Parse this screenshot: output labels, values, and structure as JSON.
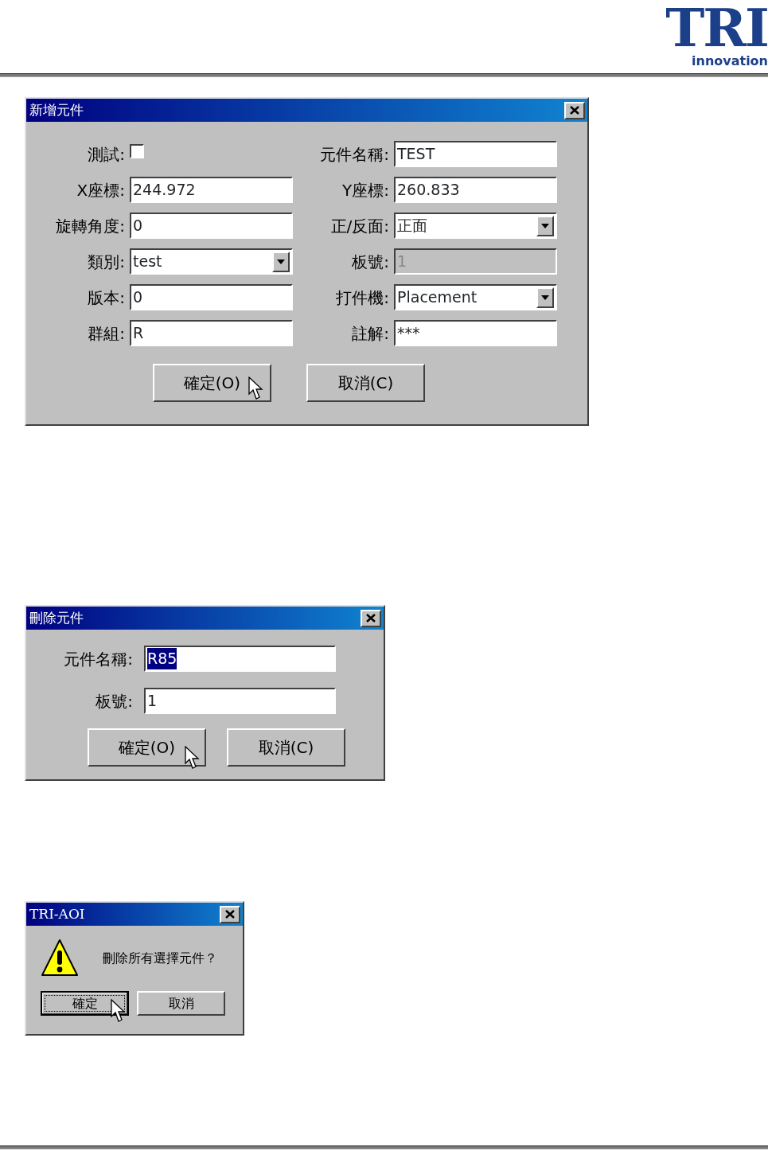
{
  "header": {
    "logo": "TRI",
    "tagline": "innovation"
  },
  "add_dialog": {
    "title": "新增元件",
    "left_fields": [
      {
        "kind": "checkbox",
        "label": "測試:",
        "checked": false,
        "disabled": false
      },
      {
        "kind": "text",
        "label": "X座標:",
        "value": "244.972",
        "disabled": false
      },
      {
        "kind": "text",
        "label": "旋轉角度:",
        "value": "0",
        "disabled": false
      },
      {
        "kind": "combo",
        "label": "類別:",
        "value": "test",
        "disabled": false
      },
      {
        "kind": "text",
        "label": "版本:",
        "value": "0",
        "disabled": false
      },
      {
        "kind": "text",
        "label": "群組:",
        "value": "R",
        "disabled": false
      }
    ],
    "right_fields": [
      {
        "kind": "text",
        "label": "元件名稱:",
        "value": "TEST",
        "disabled": false
      },
      {
        "kind": "text",
        "label": "Y座標:",
        "value": "260.833",
        "disabled": false
      },
      {
        "kind": "combo",
        "label": "正/反面:",
        "value": "正面",
        "disabled": false
      },
      {
        "kind": "text",
        "label": "板號:",
        "value": "1",
        "disabled": true
      },
      {
        "kind": "combo",
        "label": "打件機:",
        "value": "Placement",
        "disabled": false
      },
      {
        "kind": "text",
        "label": "註解:",
        "value": "***",
        "disabled": false
      }
    ],
    "buttons": [
      {
        "label": "確定(O)",
        "pointer": true,
        "focused": false
      },
      {
        "label": "取消(C)",
        "pointer": false,
        "focused": false
      }
    ]
  },
  "delete_dialog": {
    "title": "刪除元件",
    "fields": [
      {
        "label": "元件名稱:",
        "value": "R85",
        "selected_text": true
      },
      {
        "label": "板號:",
        "value": "1",
        "selected_text": false
      }
    ],
    "buttons": [
      {
        "label": "確定(O)",
        "pointer": true,
        "focused": false
      },
      {
        "label": "取消(C)",
        "pointer": false,
        "focused": false
      }
    ]
  },
  "confirm_dialog": {
    "title": "TRI-AOI",
    "message": "刪除所有選擇元件？",
    "buttons": [
      {
        "label": "確定",
        "pointer": true,
        "focused": true
      },
      {
        "label": "取消",
        "pointer": false,
        "focused": false
      }
    ]
  }
}
